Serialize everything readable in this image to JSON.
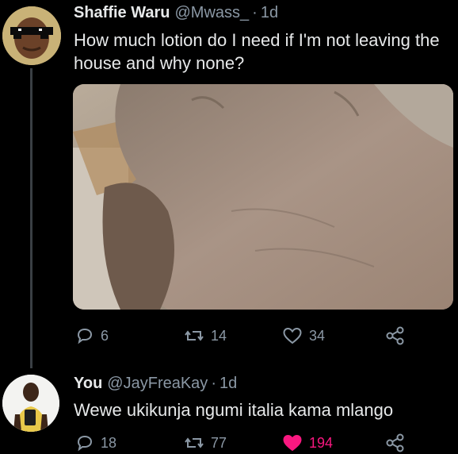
{
  "tweet1": {
    "display_name": "Shaffie Waru",
    "handle": "@Mwass_",
    "dot": "·",
    "time": "1d",
    "text": "How much lotion do I need if I'm not leaving the house and why none?",
    "media_icon": "photo-of-dry-hand",
    "actions": {
      "reply_count": "6",
      "retweet_count": "14",
      "like_count": "34"
    }
  },
  "tweet2": {
    "display_name": "You",
    "handle": "@JayFreaKay",
    "dot": "·",
    "time": "1d",
    "text": "Wewe ukikunja ngumi italia kama mlango",
    "actions": {
      "reply_count": "18",
      "retweet_count": "77",
      "like_count": "194",
      "liked": true
    }
  },
  "colors": {
    "background": "#000000",
    "text": "#e7e9ea",
    "muted": "#8b98a5",
    "like_active": "#f91880",
    "thread_line": "#3a3f44"
  }
}
